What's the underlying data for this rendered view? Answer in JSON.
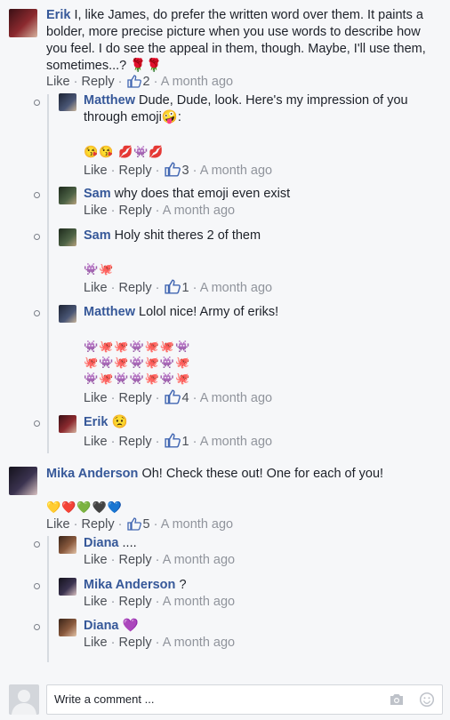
{
  "actions": {
    "like": "Like",
    "reply": "Reply",
    "sep": "·"
  },
  "comments": [
    {
      "name": "Erik",
      "text": "I, like James, do prefer the written word over them. It paints a bolder, more precise picture when you use words to describe how you feel. I do see the appeal in them, though. Maybe, I'll use them, sometimes...? 🌹🌹",
      "likes": "2",
      "time": "A month ago"
    },
    {
      "name": "Matthew",
      "text": "Dude, Dude, look. Here's my impression of you through emoji🤪:",
      "emoji": "😘😘 💋👾💋",
      "likes": "3",
      "time": "A month ago"
    },
    {
      "name": "Sam",
      "text": "why does that emoji even exist",
      "time": "A month ago"
    },
    {
      "name": "Sam",
      "text": "Holy shit theres 2 of them",
      "emoji": "👾🐙",
      "likes": "1",
      "time": "A month ago"
    },
    {
      "name": "Matthew",
      "text": "Lolol nice! Army of eriks!",
      "emoji_lines": [
        "👾🐙🐙👾🐙🐙👾",
        "🐙👾🐙👾🐙👾🐙",
        "👾🐙👾👾🐙👾🐙"
      ],
      "likes": "4",
      "time": "A month ago"
    },
    {
      "name": "Erik",
      "text": "😟",
      "likes": "1",
      "time": "A month ago"
    },
    {
      "name": "Mika Anderson",
      "text": "Oh! Check these out! One for each of you!",
      "emoji": "💛❤️💚🖤💙",
      "likes": "5",
      "time": "A month ago"
    },
    {
      "name": "Diana",
      "text": "....",
      "time": "A month ago"
    },
    {
      "name": "Mika Anderson",
      "text": "?",
      "time": "A month ago"
    },
    {
      "name": "Diana",
      "text": "💜",
      "time": "A month ago"
    }
  ],
  "composer": {
    "placeholder": "Write a comment ..."
  },
  "colors": {
    "link": "#365899",
    "meta": "#90949c",
    "like_blue": "#4267b2"
  }
}
